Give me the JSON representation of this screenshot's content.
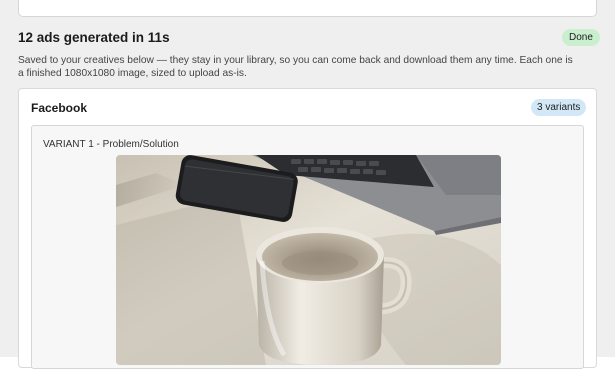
{
  "status": {
    "title": "12 ads generated in 11s",
    "badge": "Done",
    "badge_color": "#c9efcf",
    "description": "Saved to your creatives below — they stay in your library, so you can come back and download them any time. Each one is a finished 1080x1080 image, sized to upload as-is."
  },
  "platform": {
    "title": "Facebook",
    "badge": "3 variants",
    "badge_color": "#d3e8f6"
  },
  "variant": {
    "label": "VARIANT 1 - Problem/Solution",
    "image_subject": "laptop, smartphone and ceramic mug on a desk"
  }
}
